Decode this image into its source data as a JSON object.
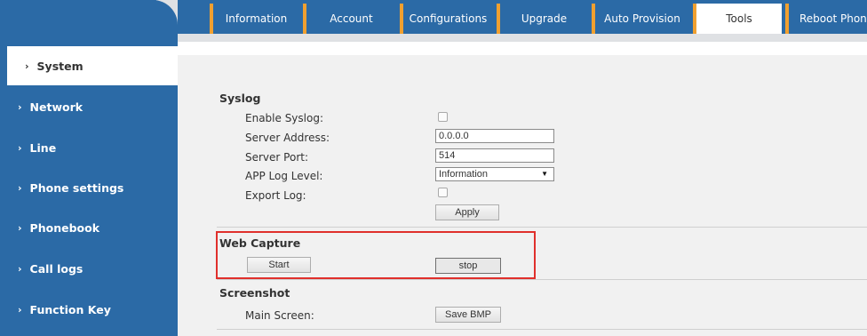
{
  "tabs": [
    {
      "label": "Information"
    },
    {
      "label": "Account"
    },
    {
      "label": "Configurations"
    },
    {
      "label": "Upgrade"
    },
    {
      "label": "Auto Provision"
    },
    {
      "label": "Tools",
      "active": true
    },
    {
      "label": "Reboot Phone"
    }
  ],
  "sidebar": {
    "items": [
      {
        "label": "System",
        "active": true
      },
      {
        "label": "Network"
      },
      {
        "label": "Line"
      },
      {
        "label": "Phone settings"
      },
      {
        "label": "Phonebook"
      },
      {
        "label": "Call logs"
      },
      {
        "label": "Function Key"
      }
    ],
    "chevron": "›"
  },
  "syslog": {
    "title": "Syslog",
    "enable_label": "Enable Syslog:",
    "enable_checked": false,
    "server_address_label": "Server Address:",
    "server_address_value": "0.0.0.0",
    "server_port_label": "Server Port:",
    "server_port_value": "514",
    "log_level_label": "APP Log Level:",
    "log_level_value": "Information",
    "export_label": "Export Log:",
    "export_checked": false,
    "apply_label": "Apply"
  },
  "web_capture": {
    "title": "Web Capture",
    "start_label": "Start",
    "stop_label": "stop",
    "highlight_color": "#e0302c"
  },
  "screenshot": {
    "title": "Screenshot",
    "main_screen_label": "Main Screen:",
    "save_label": "Save BMP"
  },
  "colors": {
    "brand_blue": "#2b6aa6",
    "tab_accent": "#f0a030"
  }
}
